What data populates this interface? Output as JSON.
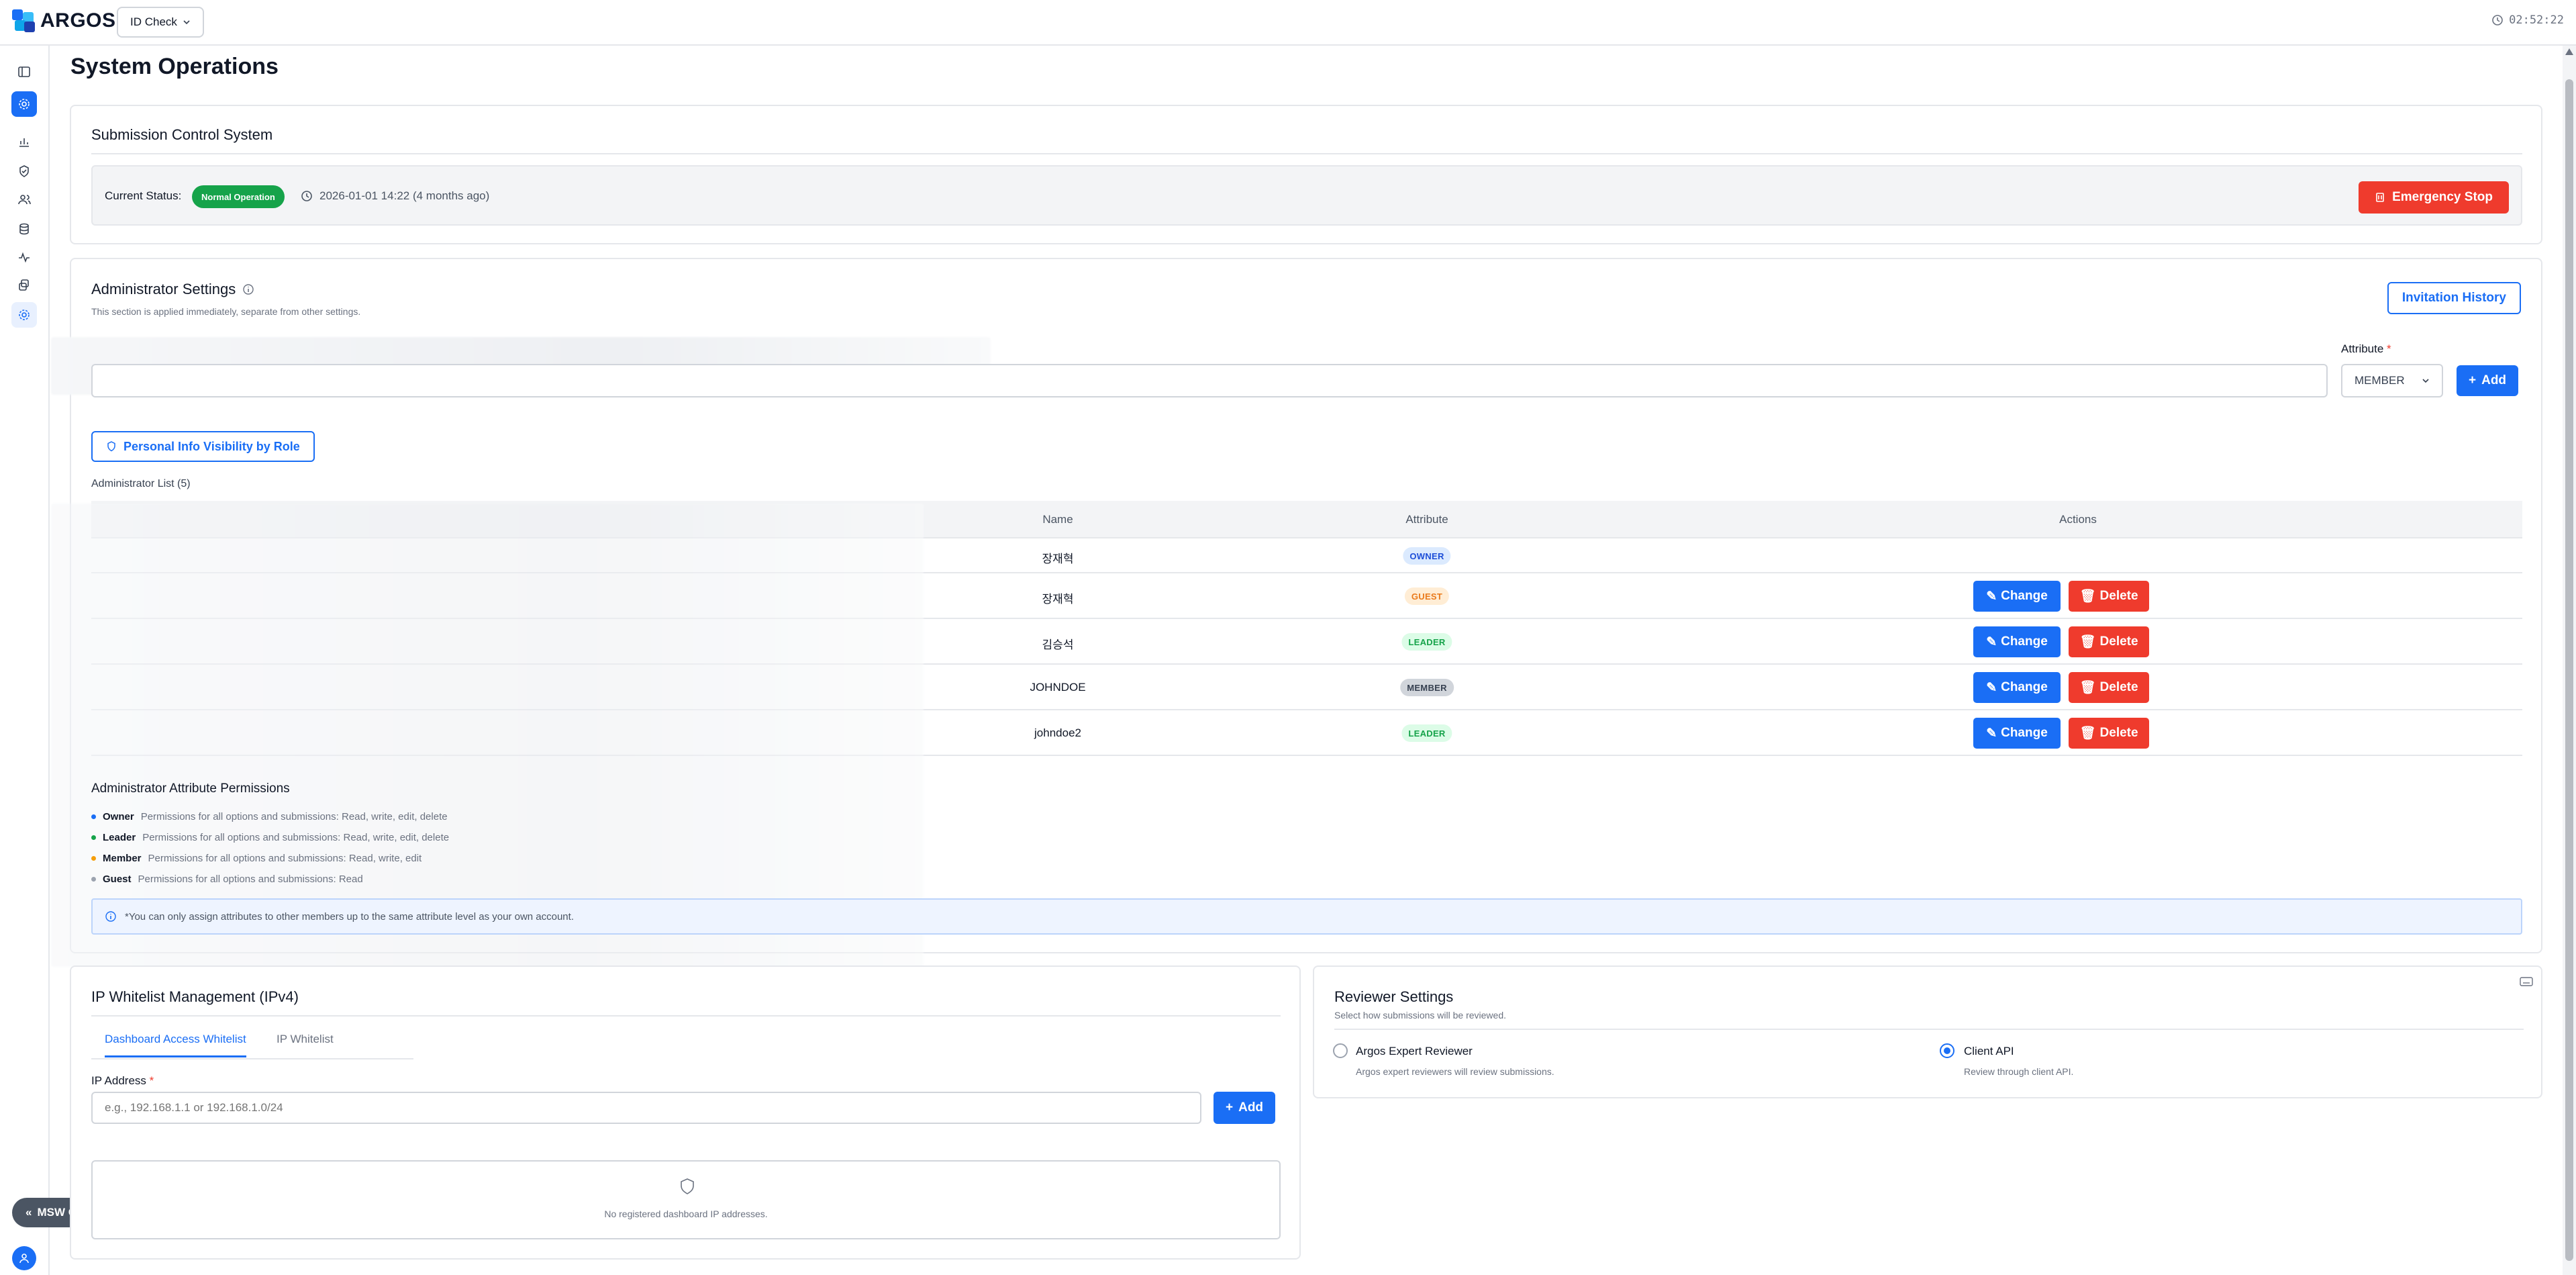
{
  "header": {
    "logo_text": "ARGOS",
    "product_select": "ID Check",
    "clock": "02:52:22"
  },
  "sidebar": {
    "items": [
      {
        "icon": "panel-toggle-icon"
      },
      {
        "icon": "gear-icon",
        "state": "active"
      },
      {
        "icon": "bar-chart-icon"
      },
      {
        "icon": "shield-check-icon"
      },
      {
        "icon": "users-icon"
      },
      {
        "icon": "database-icon"
      },
      {
        "icon": "activity-icon"
      },
      {
        "icon": "layers-icon"
      },
      {
        "icon": "settings-icon",
        "state": "current"
      }
    ],
    "msw_label": "MSW OFF"
  },
  "page": {
    "title": "System Operations"
  },
  "submission_control": {
    "title": "Submission Control System",
    "status_label": "Current Status:",
    "status_badge": "Normal Operation",
    "status_time": "2026-01-01 14:22 (4 months ago)",
    "emergency_button": "Emergency Stop"
  },
  "admin_settings": {
    "title": "Administrator Settings",
    "subtitle": "This section is applied immediately, separate from other settings.",
    "invitation_history_button": "Invitation History",
    "attribute_label": "Attribute",
    "attribute_required": "*",
    "attribute_value": "MEMBER",
    "add_button": "Add",
    "visibility_button": "Personal Info Visibility by Role",
    "list_title": "Administrator List (5)",
    "columns": {
      "name": "Name",
      "attribute": "Attribute",
      "actions": "Actions"
    },
    "rows": [
      {
        "name": "장재혁",
        "attribute": "OWNER",
        "actions": false
      },
      {
        "name": "장재혁",
        "attribute": "GUEST",
        "actions": true
      },
      {
        "name": "김승석",
        "attribute": "LEADER",
        "actions": true
      },
      {
        "name": "JOHNDOE",
        "attribute": "MEMBER",
        "actions": true
      },
      {
        "name": "johndoe2",
        "attribute": "LEADER",
        "actions": true
      }
    ],
    "change_label": "Change",
    "delete_label": "Delete",
    "permissions_title": "Administrator Attribute Permissions",
    "permissions": [
      {
        "role": "Owner",
        "desc": "Permissions for all options and submissions: Read, write, edit, delete",
        "color": "#1a6ef5"
      },
      {
        "role": "Leader",
        "desc": "Permissions for all options and submissions: Read, write, edit, delete",
        "color": "#16a34a"
      },
      {
        "role": "Member",
        "desc": "Permissions for all options and submissions: Read, write, edit",
        "color": "#f59e0b"
      },
      {
        "role": "Guest",
        "desc": "Permissions for all options and submissions: Read",
        "color": "#9ca3af"
      }
    ],
    "note": "*You can only assign attributes to other members up to the same attribute level as your own account."
  },
  "ip_whitelist": {
    "title": "IP Whitelist Management (IPv4)",
    "tabs": [
      "Dashboard Access Whitelist",
      "IP Whitelist"
    ],
    "field_label": "IP Address",
    "field_required": "*",
    "placeholder": "e.g., 192.168.1.1 or 192.168.1.0/24",
    "add_button": "Add",
    "empty_text": "No registered dashboard IP addresses."
  },
  "reviewer_settings": {
    "title": "Reviewer Settings",
    "subtitle": "Select how submissions will be reviewed.",
    "options": [
      {
        "label": "Argos Expert Reviewer",
        "desc": "Argos expert reviewers will review submissions.",
        "checked": false
      },
      {
        "label": "Client API",
        "desc": "Review through client API.",
        "checked": true
      }
    ]
  },
  "colors": {
    "primary": "#1a6ef5",
    "danger": "#ef3b2d",
    "success": "#16a34a"
  }
}
